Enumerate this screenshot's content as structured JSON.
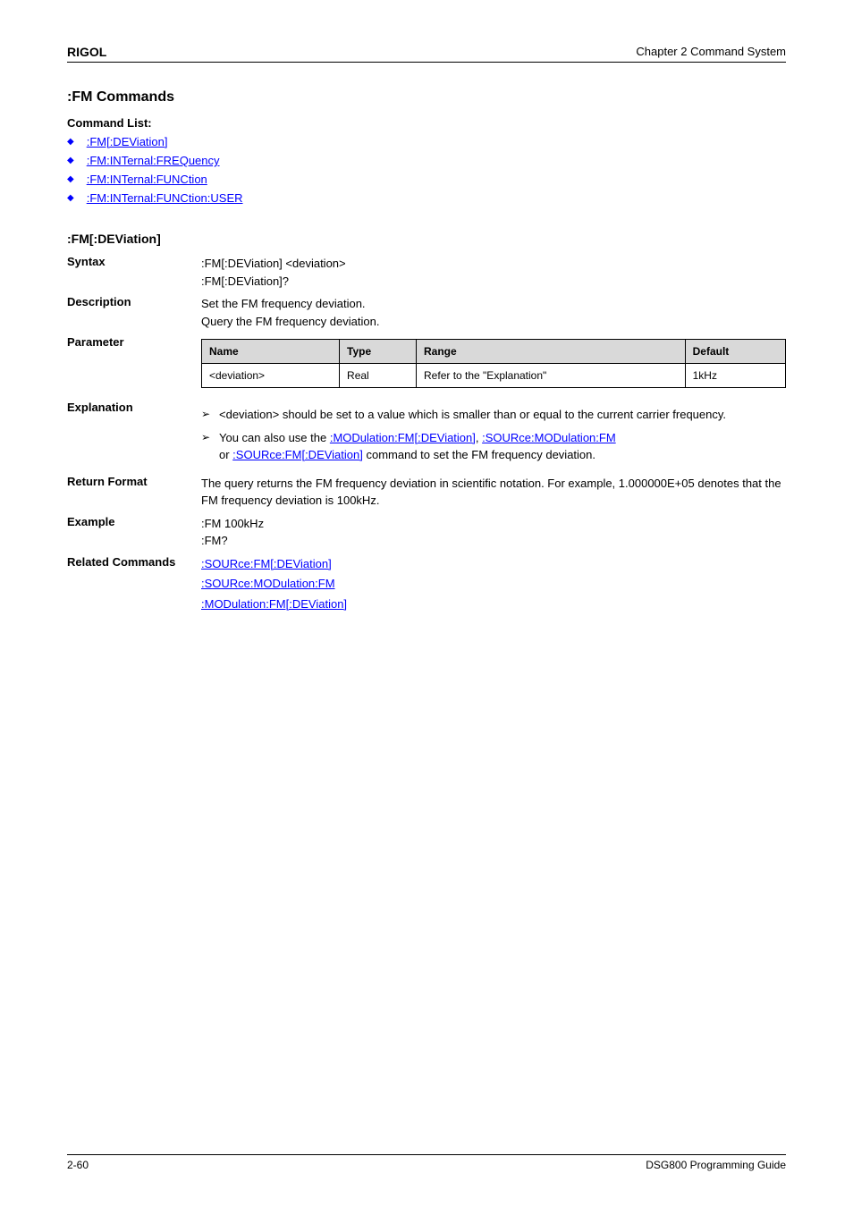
{
  "header": {
    "brand": "RIGOL",
    "chapter": "Chapter 2 Command System"
  },
  "section": {
    "title": ":FM Commands",
    "commands": [
      {
        "text": ":FM[:DEViation]"
      },
      {
        "text": ":FM:INTernal:FREQuency"
      },
      {
        "text": ":FM:INTernal:FUNCtion"
      },
      {
        "text": ":FM:INTernal:FUNCtion:USER"
      }
    ]
  },
  "detail": {
    "name": ":FM[:DEViation]",
    "syntax": {
      "label": "Syntax",
      "line1": ":FM[:DEViation] <deviation>",
      "line2": ":FM[:DEViation]?"
    },
    "description": {
      "label": "Description",
      "line1": "Set the FM frequency deviation.",
      "line2": "Query the FM frequency deviation."
    },
    "parameter": {
      "label": "Parameter",
      "headers": {
        "name": "Name",
        "type": "Type",
        "range": "Range",
        "default": "Default"
      },
      "row": {
        "name": "<deviation>",
        "type": "Real",
        "range": "Refer to the \"Explanation\"",
        "default": "1kHz"
      }
    },
    "explanation": {
      "label": "Explanation",
      "item1": "<deviation> should be set to a value which is smaller than or equal to the current carrier frequency.",
      "item2_pre": "You can also use the ",
      "item2_link1": ":MODulation:FM[:DEViation]",
      "item2_mid1": ", ",
      "item2_link2": ":SOURce:MODulation:FM",
      "item2_post1": "",
      "item2_line2": "or ",
      "item2_link3": ":SOURce:FM[:DEViation]",
      "item2_line2_post": " command to set the FM frequency deviation."
    },
    "return_format": {
      "label": "Return Format",
      "text": "The query returns the FM frequency deviation in scientific notation. For example, 1.000000E+05 denotes that the FM frequency deviation is 100kHz."
    },
    "example": {
      "label": "Example",
      "line1": ":FM 100kHz",
      "line2": ":FM?"
    },
    "related": {
      "label": "Related Commands",
      "items": [
        ":SOURce:FM[:DEViation]",
        ":SOURce:MODulation:FM",
        ":MODulation:FM[:DEViation]"
      ]
    }
  },
  "footer": {
    "page_num": "2-60",
    "doc_id": "DSG800 Programming Guide"
  }
}
